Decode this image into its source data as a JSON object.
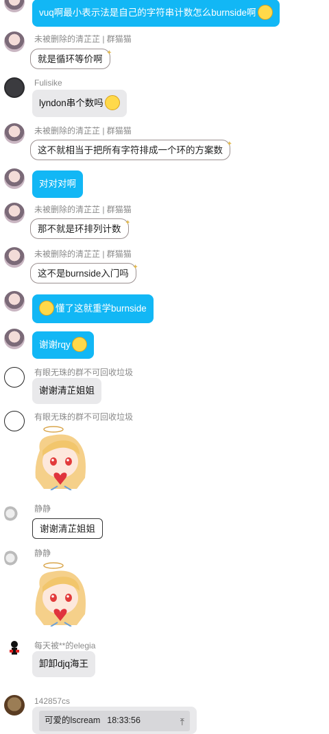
{
  "messages": [
    {
      "text": "vuq啊最小表示法是自己的字符串计数怎么burnside啊"
    },
    {
      "name": "未被删除的清芷芷 | 群猫猫",
      "text": "就是循环等价啊"
    },
    {
      "name": "Fulisike",
      "text": "lyndon串个数吗"
    },
    {
      "name": "未被删除的清芷芷 | 群猫猫",
      "text": "这不就相当于把所有字符排成一个环的方案数"
    },
    {
      "text": "对对对啊"
    },
    {
      "name": "未被删除的清芷芷 | 群猫猫",
      "text": "那不就是环排列计数"
    },
    {
      "name": "未被删除的清芷芷 | 群猫猫",
      "text": "这不是burnside入门吗"
    },
    {
      "text": "懂了这就重学burnside"
    },
    {
      "text": "谢谢rqy"
    },
    {
      "name": "有眼无珠的群不可回收垃圾",
      "text": "谢谢清芷姐姐"
    },
    {
      "name": "有眼无珠的群不可回收垃圾"
    },
    {
      "name": "静静",
      "text": "谢谢清芷姐姐"
    },
    {
      "name": "静静"
    },
    {
      "name": "每天被**的elegia",
      "text": "卸卸djq海王"
    },
    {
      "name": "142857cs",
      "file_name": "可爱的lscream",
      "file_time": "18:33:56"
    }
  ],
  "colors": {
    "self_bubble": "#12b7f5",
    "other_bubble": "#e9e9eb",
    "name_text": "#8a8a8a"
  }
}
